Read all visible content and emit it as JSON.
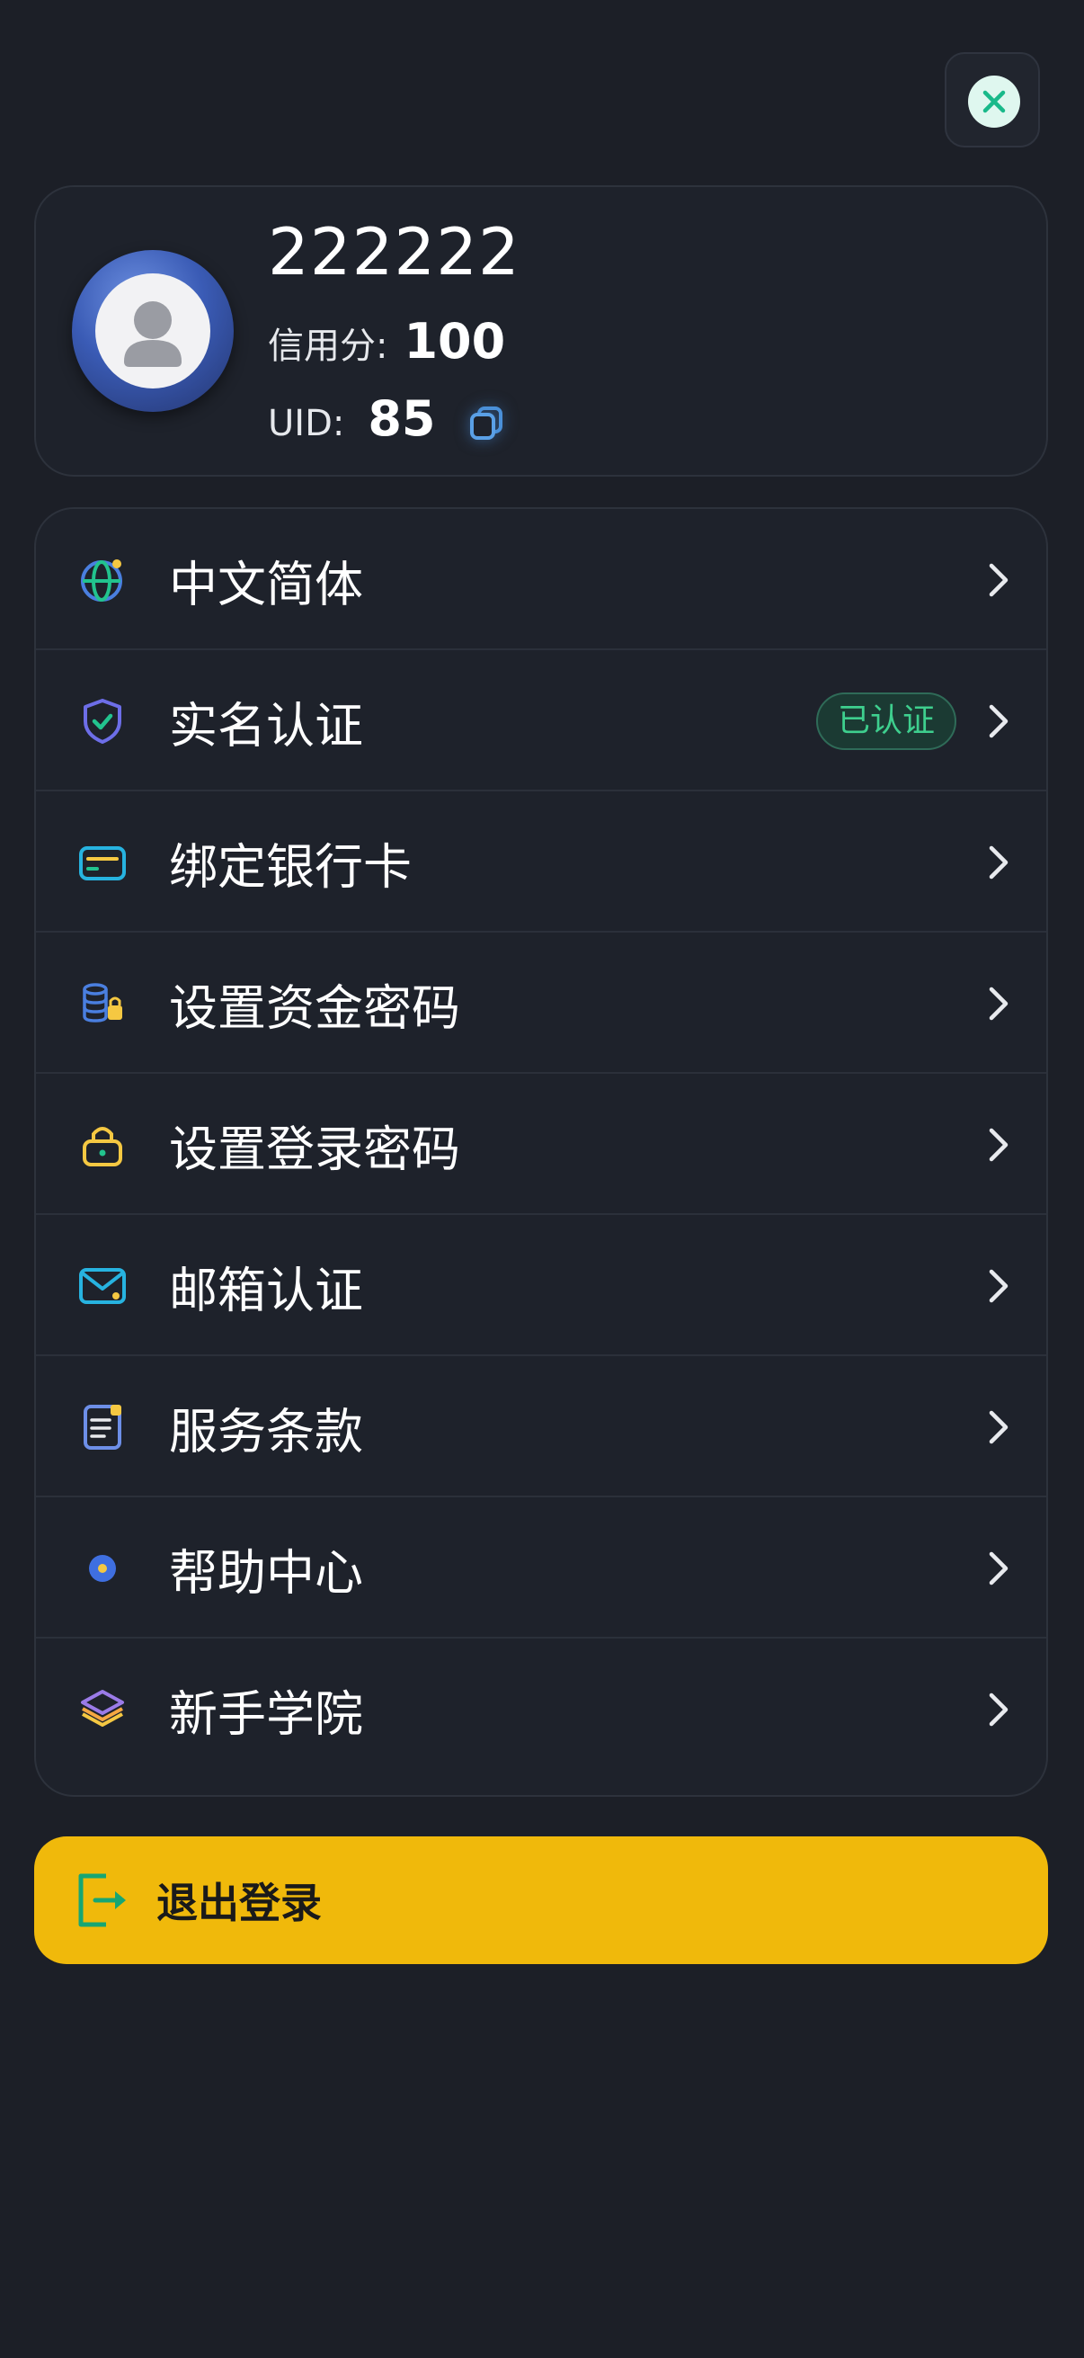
{
  "profile": {
    "username": "222222",
    "credit_label": "信用分:",
    "credit_value": "100",
    "uid_label": "UID:",
    "uid_value": "85"
  },
  "menu": {
    "items": [
      {
        "label": "中文简体",
        "icon": "globe-icon"
      },
      {
        "label": "实名认证",
        "icon": "shield-check-icon",
        "badge": "已认证"
      },
      {
        "label": "绑定银行卡",
        "icon": "bank-card-icon"
      },
      {
        "label": "设置资金密码",
        "icon": "fund-lock-icon"
      },
      {
        "label": "设置登录密码",
        "icon": "lock-icon"
      },
      {
        "label": "邮箱认证",
        "icon": "mail-icon"
      },
      {
        "label": "服务条款",
        "icon": "document-icon"
      },
      {
        "label": "帮助中心",
        "icon": "help-dot-icon"
      },
      {
        "label": "新手学院",
        "icon": "layers-icon"
      }
    ]
  },
  "logout": {
    "label": "退出登录",
    "icon": "logout-icon"
  },
  "colors": {
    "background": "#1c1f27",
    "card": "#1e222b",
    "accent_yellow": "#f0b90b",
    "verified_green": "#3ecf8e",
    "close_mint": "#dff7ef"
  }
}
